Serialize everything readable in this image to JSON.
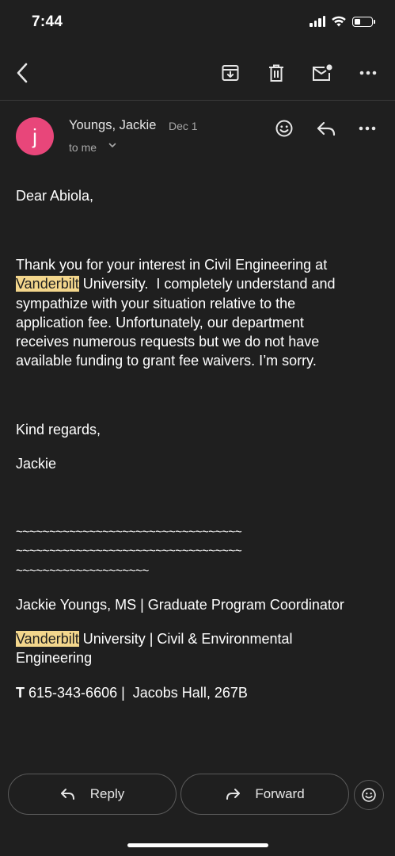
{
  "status_bar": {
    "time": "7:44"
  },
  "email": {
    "avatar_letter": "j",
    "sender": "Youngs, Jackie",
    "date": "Dec 1",
    "recipient": "to me",
    "greeting": "Dear Abiola,",
    "para": {
      "l1": "Thank you for your interest in Civil Engineering at",
      "l2_hl": "Vanderbilt",
      "l2_rest": " University.  I completely understand and",
      "l3": "sympathize with your situation relative to the",
      "l4": "application fee.  Unfortunately, our department",
      "l5": "receives numerous requests but we do not have",
      "l6": "available funding to grant fee waivers.  I’m sorry."
    },
    "closing": "Kind regards,",
    "name": "Jackie",
    "sig_line1": "~~~~~~~~~~~~~~~~~~~~~~~~~~~~~~~~~~",
    "sig_line2": "~~~~~~~~~~~~~~~~~~~~~~~~~~~~~~~~~~",
    "sig_line3": "~~~~~~~~~~~~~~~~~~~~",
    "sig_title": "Jackie Youngs, MS | Graduate Program Coordinator",
    "sig_univ_hl": "Vanderbilt",
    "sig_univ_rest": " University | Civil & Environmental",
    "sig_univ_line2": "Engineering",
    "sig_phone_label": "T",
    "sig_phone_rest": " 615-343-6606 |  Jacobs Hall, 267B"
  },
  "actions": {
    "reply": "Reply",
    "forward": "Forward"
  },
  "icons": {
    "back": "chevron-left-icon",
    "archive": "archive-icon",
    "delete": "trash-icon",
    "unread": "mark-unread-icon",
    "more": "more-horizontal-icon",
    "emoji": "emoji-icon",
    "reply": "reply-icon",
    "forward": "forward-icon"
  },
  "colors": {
    "background": "#1f1f1f",
    "avatar": "#e8467a",
    "highlight": "#f3d68c"
  }
}
